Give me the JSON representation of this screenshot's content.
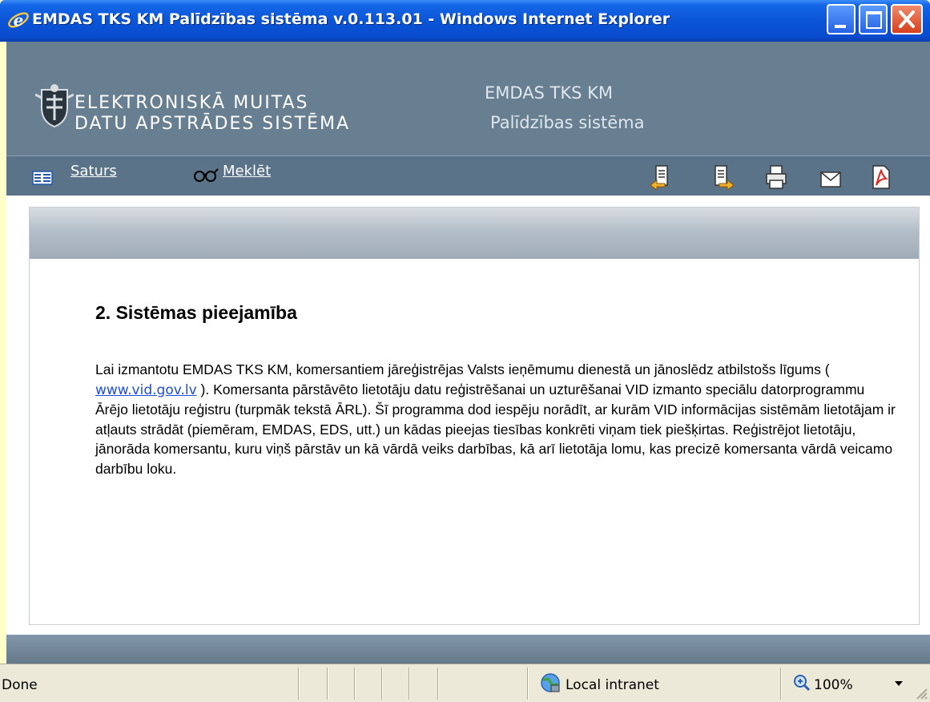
{
  "window": {
    "title": "EMDAS TKS KM Palīdzības sistēma v.0.113.01 - Windows Internet Explorer"
  },
  "header": {
    "logo_line1": "ELEKTRONISKĀ MUITAS",
    "logo_line2": "DATU APSTRĀDES SISTĒMA",
    "app_title_line1": "EMDAS TKS KM",
    "app_title_line2": "Palīdzības sistēma"
  },
  "toolbar": {
    "contents_label": "Saturs",
    "search_label": "Meklēt",
    "buttons": [
      "previous-topic-icon",
      "next-topic-icon",
      "print-icon",
      "email-icon",
      "pdf-icon"
    ]
  },
  "content": {
    "heading": "2. Sistēmas pieejamība",
    "paragraph_before_link": "Lai izmantotu EMDAS TKS KM, komersantiem jāreģistrējas Valsts ieņēmumu dienestā un jānoslēdz atbilstošs līgums ( ",
    "link_text": "www.vid.gov.lv",
    "paragraph_after_link": " ). Komersanta pārstāvēto lietotāju datu reģistrēšanai un uzturēšanai VID izmanto speciālu datorprogrammu Ārējo lietotāju reģistru (turpmāk tekstā ĀRL). Šī programma dod iespēju norādīt, ar kurām VID informācijas sistēmām lietotājam ir atļauts strādāt (piemēram, EMDAS, EDS, utt.) un kādas pieejas tiesības konkrēti viņam tiek piešķirtas. Reģistrējot lietotāju, jānorāda komersantu, kuru viņš pārstāv un kā vārdā veiks darbības, kā arī lietotāja lomu, kas precizē komersanta vārdā veicamo darbību loku."
  },
  "statusbar": {
    "status": "Done",
    "zone": "Local intranet",
    "zoom": "100%"
  },
  "colors": {
    "titlebar": "#0a55d6",
    "header_bg": "#687f92",
    "toolbar_bg": "#5b7388",
    "link": "#1d4ed8",
    "statusbar": "#ece9d8"
  }
}
